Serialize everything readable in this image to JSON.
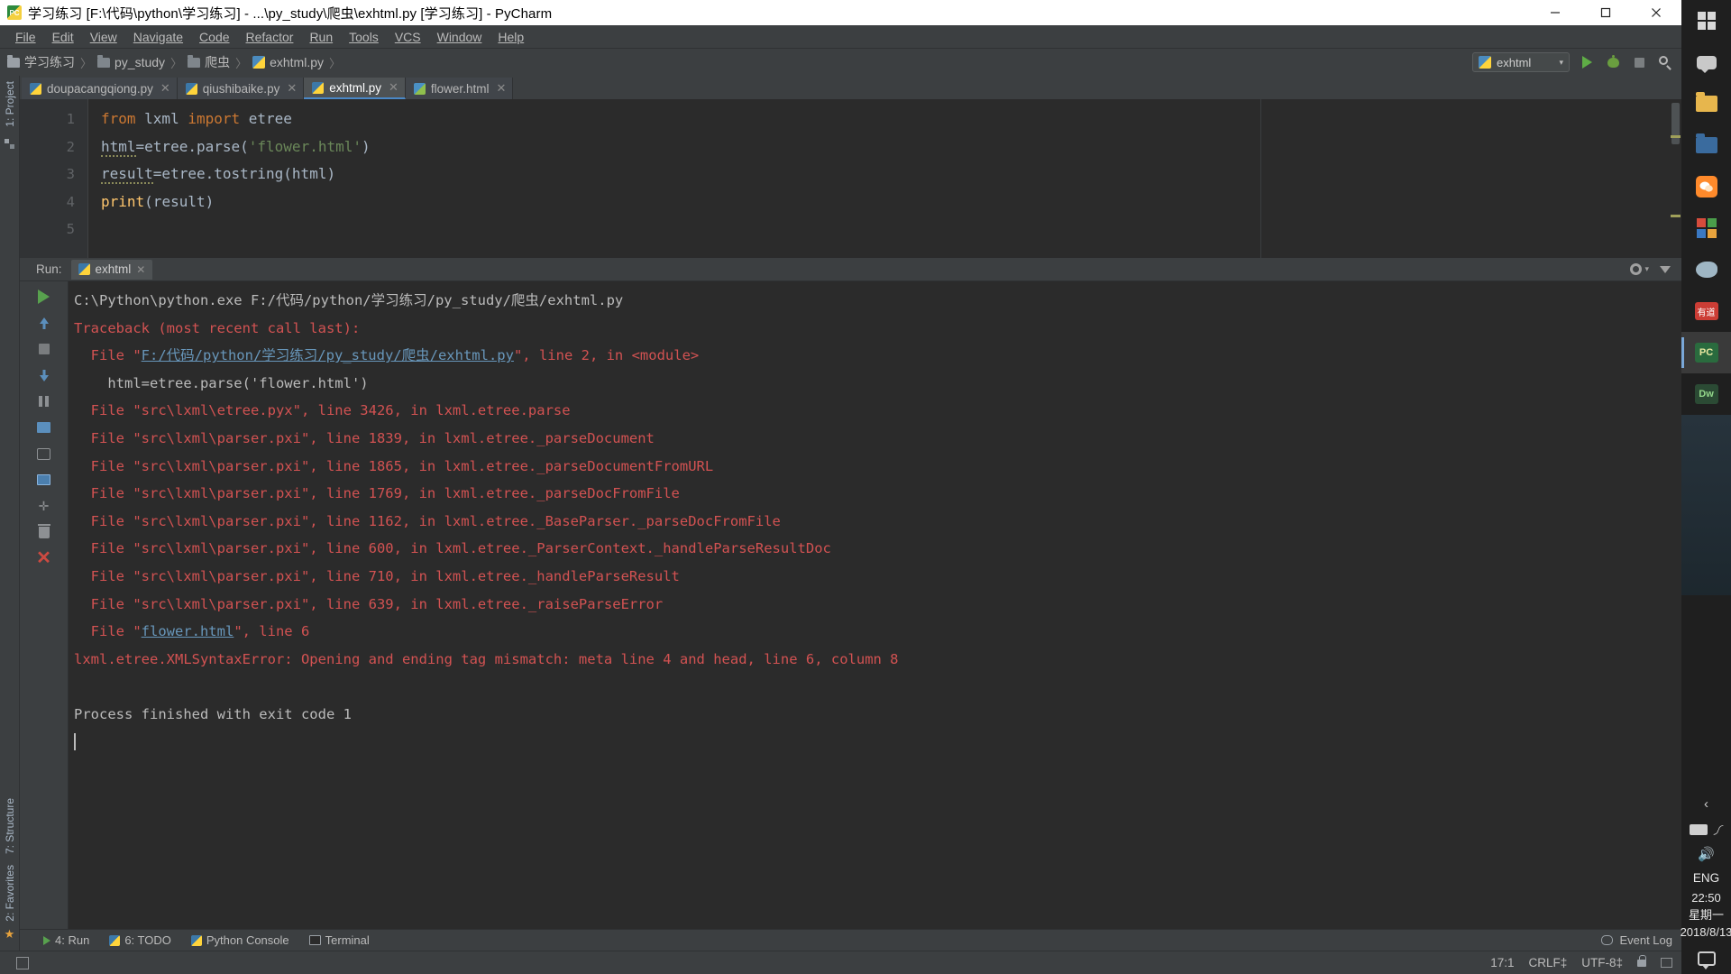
{
  "window": {
    "title": "学习练习 [F:\\代码\\python\\学习练习] - ...\\py_study\\爬虫\\exhtml.py [学习练习] - PyCharm",
    "minimize": "—",
    "maximize": "▢",
    "close": "✕"
  },
  "menu": {
    "items": [
      "File",
      "Edit",
      "View",
      "Navigate",
      "Code",
      "Refactor",
      "Run",
      "Tools",
      "VCS",
      "Window",
      "Help"
    ]
  },
  "breadcrumb": {
    "items": [
      {
        "label": "学习练习",
        "icon": "folder-icon"
      },
      {
        "label": "py_study",
        "icon": "folder-icon"
      },
      {
        "label": "爬虫",
        "icon": "folder-icon"
      },
      {
        "label": "exhtml.py",
        "icon": "python-file-icon"
      }
    ],
    "separator": "〉"
  },
  "toolbar": {
    "run_config": "exhtml",
    "run_config_caret": "▾",
    "run_button": "run-icon",
    "debug_button": "debug-icon",
    "stop_button": "stop-icon",
    "search_button": "search-icon"
  },
  "editor_tabs": [
    {
      "label": "doupacangqiong.py",
      "icon": "python-file-icon",
      "active": false,
      "close": "✕"
    },
    {
      "label": "qiushibaike.py",
      "icon": "python-file-icon",
      "active": false,
      "close": "✕"
    },
    {
      "label": "exhtml.py",
      "icon": "python-file-icon",
      "active": true,
      "close": "✕"
    },
    {
      "label": "flower.html",
      "icon": "html-file-icon",
      "active": false,
      "close": "✕"
    }
  ],
  "editor": {
    "line_numbers": [
      "1",
      "2",
      "3",
      "4",
      "5"
    ],
    "lines": [
      [
        {
          "t": "from",
          "c": "kw"
        },
        {
          "t": " lxml ",
          "c": "plain"
        },
        {
          "t": "import",
          "c": "kw"
        },
        {
          "t": " etree",
          "c": "plain"
        }
      ],
      [
        {
          "t": "html",
          "c": "squig"
        },
        {
          "t": "=etree.parse(",
          "c": "plain"
        },
        {
          "t": "'flower.html'",
          "c": "str"
        },
        {
          "t": ")",
          "c": "plain"
        }
      ],
      [
        {
          "t": "result",
          "c": "squig"
        },
        {
          "t": "=etree.tostring(html)",
          "c": "plain"
        }
      ],
      [
        {
          "t": "print",
          "c": "fn"
        },
        {
          "t": "(result)",
          "c": "plain"
        }
      ],
      []
    ]
  },
  "run_window": {
    "label": "Run:",
    "tab": "exhtml",
    "tab_close": "✕",
    "settings_icon": "gear-icon",
    "settings_caret": "▾",
    "export_icon": "export-icon",
    "toolbar_icons": [
      "rerun-icon",
      "scroll-up-icon",
      "stop-icon",
      "scroll-down-icon",
      "pause-icon",
      "print-icon",
      "soft-wrap-icon",
      "scroll-to-end-icon",
      "pin-tab-icon",
      "clear-all-icon",
      "close-icon"
    ],
    "console": [
      [
        {
          "t": "C:\\Python\\python.exe F:/代码/python/学习练习/py_study/爬虫/exhtml.py",
          "c": "c-white"
        }
      ],
      [
        {
          "t": "Traceback (most recent call last):",
          "c": "c-red"
        }
      ],
      [
        {
          "t": "  File \"",
          "c": "c-red"
        },
        {
          "t": "F:/代码/python/学习练习/py_study/爬虫/exhtml.py",
          "c": "c-link"
        },
        {
          "t": "\", line 2, in <module>",
          "c": "c-red"
        }
      ],
      [
        {
          "t": "    html=etree.parse('flower.html')",
          "c": "c-white"
        }
      ],
      [
        {
          "t": "  File \"src\\lxml\\etree.pyx\", line 3426, in lxml.etree.parse",
          "c": "c-red"
        }
      ],
      [
        {
          "t": "  File \"src\\lxml\\parser.pxi\", line 1839, in lxml.etree._parseDocument",
          "c": "c-red"
        }
      ],
      [
        {
          "t": "  File \"src\\lxml\\parser.pxi\", line 1865, in lxml.etree._parseDocumentFromURL",
          "c": "c-red"
        }
      ],
      [
        {
          "t": "  File \"src\\lxml\\parser.pxi\", line 1769, in lxml.etree._parseDocFromFile",
          "c": "c-red"
        }
      ],
      [
        {
          "t": "  File \"src\\lxml\\parser.pxi\", line 1162, in lxml.etree._BaseParser._parseDocFromFile",
          "c": "c-red"
        }
      ],
      [
        {
          "t": "  File \"src\\lxml\\parser.pxi\", line 600, in lxml.etree._ParserContext._handleParseResultDoc",
          "c": "c-red"
        }
      ],
      [
        {
          "t": "  File \"src\\lxml\\parser.pxi\", line 710, in lxml.etree._handleParseResult",
          "c": "c-red"
        }
      ],
      [
        {
          "t": "  File \"src\\lxml\\parser.pxi\", line 639, in lxml.etree._raiseParseError",
          "c": "c-red"
        }
      ],
      [
        {
          "t": "  File \"",
          "c": "c-red"
        },
        {
          "t": "flower.html",
          "c": "c-link"
        },
        {
          "t": "\", line 6",
          "c": "c-red"
        }
      ],
      [
        {
          "t": "lxml.etree.XMLSyntaxError: Opening and ending tag mismatch: meta line 4 and head, line 6, column 8",
          "c": "c-red"
        }
      ],
      [],
      [
        {
          "t": "Process finished with exit code 1",
          "c": "c-white"
        }
      ]
    ]
  },
  "left_rail": {
    "top_label": "1: Project",
    "bottom_labels": [
      "7: Structure",
      "2: Favorites"
    ],
    "star_icon": "favorites-star-icon"
  },
  "bottom_bar": {
    "items": [
      {
        "label": "4: Run",
        "icon": "run-icon"
      },
      {
        "label": "6: TODO",
        "icon": "todo-icon"
      },
      {
        "label": "Python Console",
        "icon": "python-console-icon"
      },
      {
        "label": "Terminal",
        "icon": "terminal-icon"
      }
    ],
    "event_log": "Event Log",
    "event_log_icon": "event-log-icon"
  },
  "status_bar": {
    "caret_position": "17:1",
    "line_separator": "CRLF‡",
    "encoding": "UTF-8‡",
    "lock_icon": "lock-icon",
    "branch_icon": "branch-icon"
  },
  "taskbar": {
    "buttons": [
      {
        "name": "start-button",
        "icon": "windows-logo-icon"
      },
      {
        "name": "cortana-button",
        "icon": "speech-bubble-icon"
      },
      {
        "name": "file-explorer-button",
        "icon": "folder-yellow-icon"
      },
      {
        "name": "explorer-window-button",
        "icon": "folder-blue-icon"
      },
      {
        "name": "wechat-button",
        "icon": "wechat-icon"
      },
      {
        "name": "office-button",
        "icon": "office-icon"
      },
      {
        "name": "media-button",
        "icon": "fish-icon"
      },
      {
        "name": "youdao-button",
        "icon": "youdao-icon",
        "text": "有道"
      },
      {
        "name": "pycharm-button",
        "icon": "pycharm-icon",
        "text": "PC",
        "active": true
      },
      {
        "name": "dreamweaver-button",
        "icon": "dreamweaver-icon",
        "text": "Dw"
      }
    ],
    "tray": {
      "expand": "‹",
      "language": "ENG",
      "time": "22:50",
      "weekday": "星期一",
      "date": "2018/8/13",
      "keyboard_icon": "keyboard-icon",
      "wifi_icon": "wifi-icon",
      "volume_icon": "volume-icon",
      "action_center_icon": "action-center-icon"
    }
  }
}
